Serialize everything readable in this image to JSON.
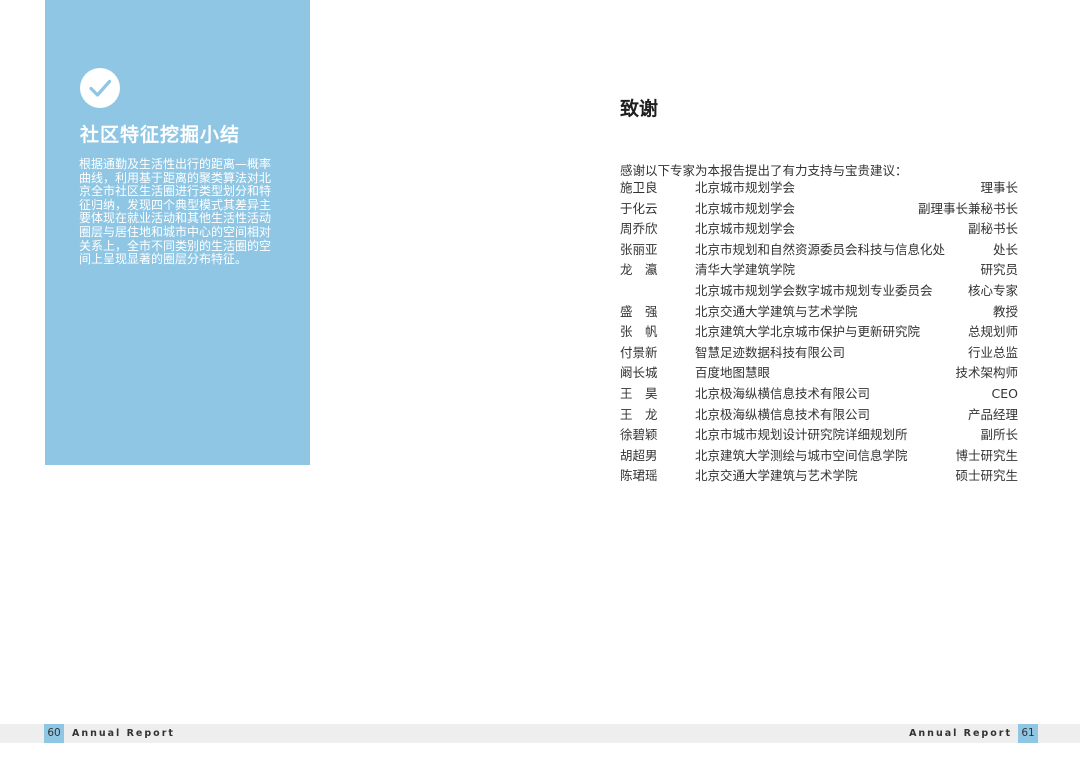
{
  "summary": {
    "title": "社区特征挖掘小结",
    "body": "根据通勤及生活性出行的距离—概率曲线，利用基于距离的聚类算法对北京全市社区生活圈进行类型划分和特征归纳，发现四个典型模式其差异主要体现在就业活动和其他生活性活动圈层与居住地和城市中心的空间相对关系上，全市不同类别的生活圈的空间上呈现显著的圈层分布特征。",
    "icon": "check-circle-icon",
    "accent_color": "#8ec6e4"
  },
  "acknowledgements": {
    "title": "致谢",
    "intro": "感谢以下专家为本报告提出了有力支持与宝贵建议：",
    "people": [
      {
        "name": "施卫良",
        "org": "北京城市规划学会",
        "role": "理事长"
      },
      {
        "name": "于化云",
        "org": "北京城市规划学会",
        "role": "副理事长兼秘书长"
      },
      {
        "name": "周乔欣",
        "org": "北京城市规划学会",
        "role": "副秘书长"
      },
      {
        "name": "张丽亚",
        "org": "北京市规划和自然资源委员会科技与信息化处",
        "role": "处长"
      },
      {
        "name": "龙　瀛",
        "org": "清华大学建筑学院",
        "role": "研究员"
      },
      {
        "name": "",
        "org": "北京城市规划学会数字城市规划专业委员会",
        "role": "核心专家"
      },
      {
        "name": "盛　强",
        "org": "北京交通大学建筑与艺术学院",
        "role": "教授"
      },
      {
        "name": "张　帆",
        "org": "北京建筑大学北京城市保护与更新研究院",
        "role": "总规划师"
      },
      {
        "name": "付景新",
        "org": "智慧足迹数据科技有限公司",
        "role": "行业总监"
      },
      {
        "name": "阚长城",
        "org": "百度地图慧眼",
        "role": "技术架构师"
      },
      {
        "name": "王　昊",
        "org": "北京极海纵横信息技术有限公司",
        "role": "CEO"
      },
      {
        "name": "王　龙",
        "org": "北京极海纵横信息技术有限公司",
        "role": "产品经理"
      },
      {
        "name": "徐碧颖",
        "org": "北京市城市规划设计研究院详细规划所",
        "role": "副所长"
      },
      {
        "name": "胡超男",
        "org": "北京建筑大学测绘与城市空间信息学院",
        "role": "博士研究生"
      },
      {
        "name": "陈珺瑶",
        "org": "北京交通大学建筑与艺术学院",
        "role": "硕士研究生"
      }
    ]
  },
  "footer": {
    "left_page": "60",
    "left_label": "Annual Report",
    "right_page": "61",
    "right_label": "Annual Report"
  }
}
